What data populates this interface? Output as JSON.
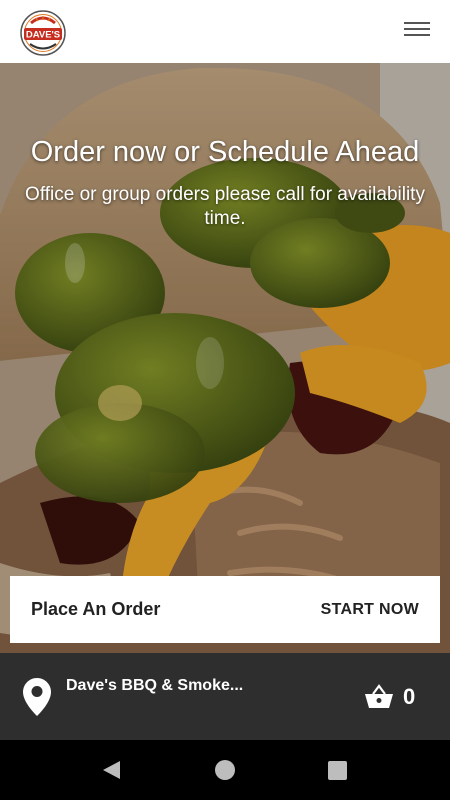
{
  "header": {
    "logo_text": "DAVE'S",
    "logo_top_text": "BBQ & SMOKEHOUSE",
    "menu_icon": "hamburger-menu-icon"
  },
  "hero": {
    "title": "Order now or Schedule Ahead",
    "subtitle": "Office or group orders please call for availability time."
  },
  "order_card": {
    "label": "Place An Order",
    "action": "START NOW"
  },
  "footer": {
    "location_icon": "map-pin-icon",
    "store_name": "Dave's BBQ & Smoke...",
    "cart_icon": "basket-icon",
    "cart_count": "0"
  },
  "system_nav": {
    "back_icon": "back-triangle-icon",
    "home_icon": "home-circle-icon",
    "recents_icon": "recents-square-icon"
  },
  "colors": {
    "footer_bg": "#2e2e2e",
    "logo_red": "#c62d1f",
    "logo_orange": "#e07a22"
  }
}
